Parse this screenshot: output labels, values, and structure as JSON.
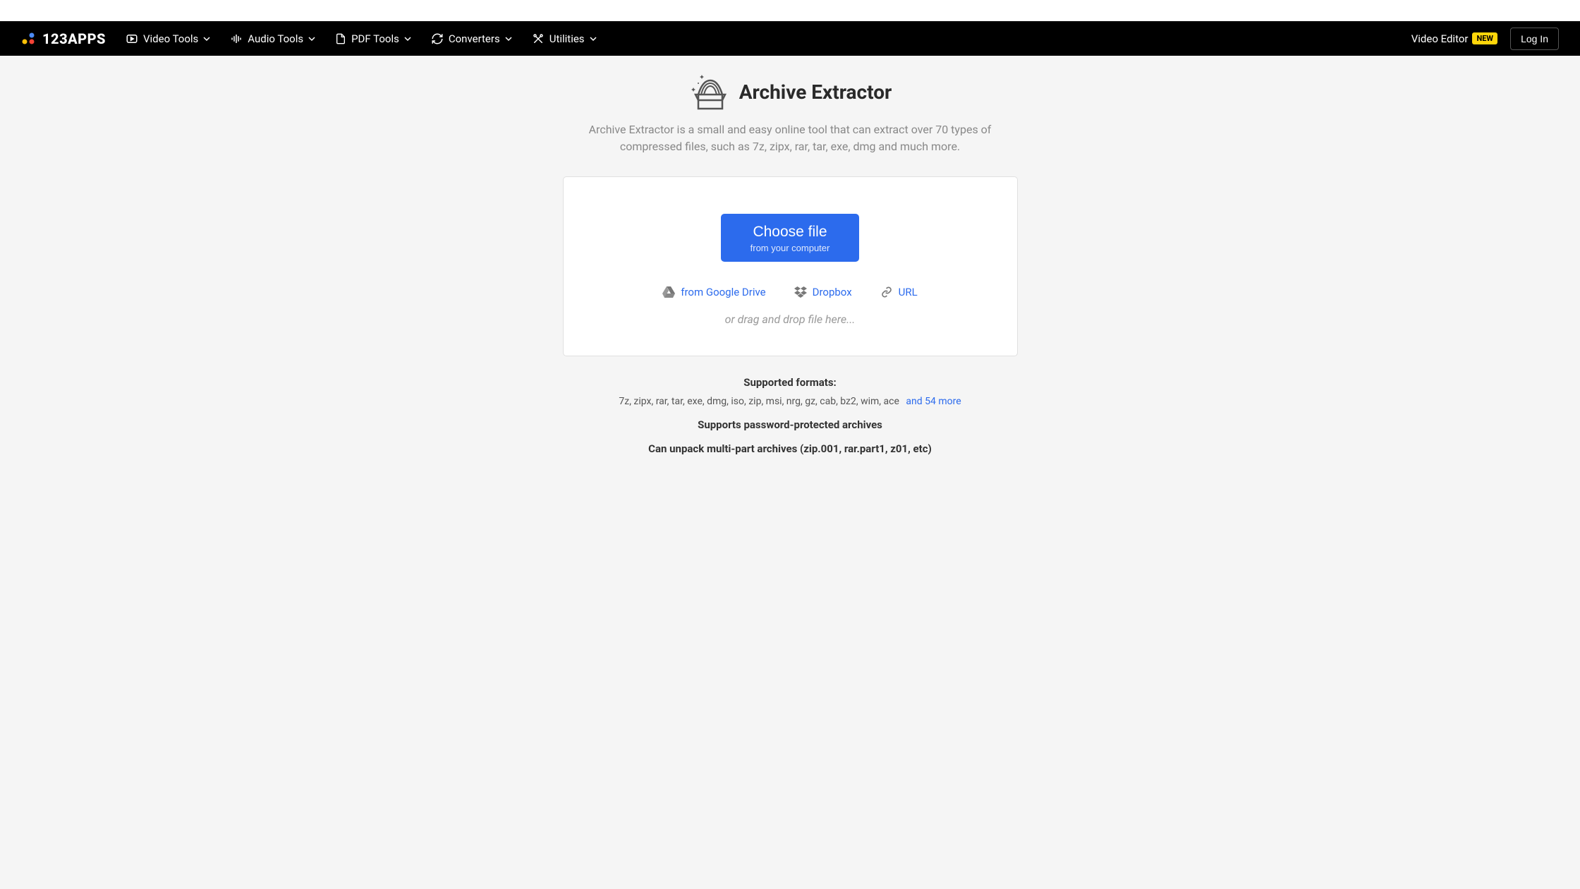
{
  "header": {
    "logo_text": "123APPS",
    "nav": [
      {
        "label": "Video Tools"
      },
      {
        "label": "Audio Tools"
      },
      {
        "label": "PDF Tools"
      },
      {
        "label": "Converters"
      },
      {
        "label": "Utilities"
      }
    ],
    "video_editor_label": "Video Editor",
    "new_badge": "NEW",
    "login_label": "Log In"
  },
  "main": {
    "title": "Archive Extractor",
    "description": "Archive Extractor is a small and easy online tool that can extract over 70 types of compressed files, such as 7z, zipx, rar, tar, exe, dmg and much more.",
    "choose_file_label": "Choose file",
    "choose_file_sub": "from your computer",
    "sources": {
      "google_drive": "from Google Drive",
      "dropbox": "Dropbox",
      "url": "URL"
    },
    "drag_drop_text": "or drag and drop file here...",
    "supported_formats_label": "Supported formats:",
    "formats_list": "7z, zipx, rar, tar, exe, dmg, iso, zip, msi, nrg, gz, cab, bz2, wim, ace",
    "more_formats": "and 54 more",
    "feature_password": "Supports password-protected archives",
    "feature_multipart": "Can unpack multi-part archives (zip.001, rar.part1, z01, etc)"
  }
}
